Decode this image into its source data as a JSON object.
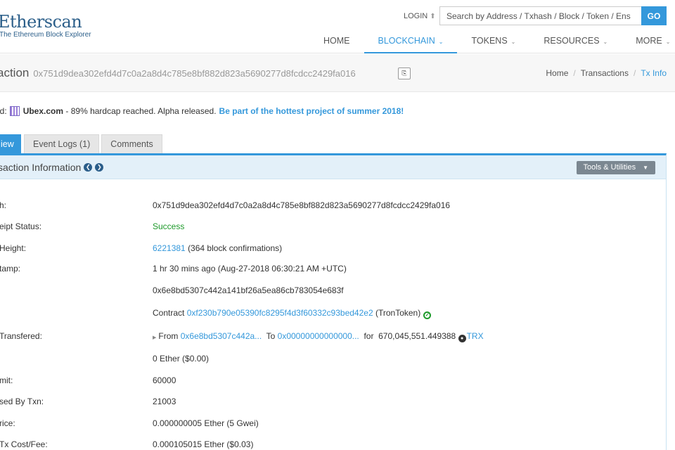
{
  "header": {
    "logo": "Etherscan",
    "logo_tagline": "The Ethereum Block Explorer",
    "login": "LOGIN",
    "search_placeholder": "Search by Address / Txhash / Block / Token / Ens",
    "go": "GO",
    "nav": [
      "HOME",
      "BLOCKCHAIN",
      "TOKENS",
      "RESOURCES",
      "MORE"
    ]
  },
  "title": {
    "heading": "action",
    "hash": "0x751d9dea302efd4d7c0a2a8d4c785e8bf882d823a5690277d8fcdcc2429fa016"
  },
  "breadcrumb": [
    "Home",
    "Transactions",
    "Tx Info"
  ],
  "sponsor": {
    "prefix": "ed:",
    "brand": "Ubex.com",
    "text": "- 89% hardcap reached. Alpha released.",
    "link": "Be part of the hottest project of summer 2018!"
  },
  "tabs": [
    "iew",
    "Event Logs (1)",
    "Comments"
  ],
  "panel": {
    "title": "saction Information",
    "tools": "Tools & Utilities"
  },
  "details": {
    "hash_label": "h:",
    "hash_value": "0x751d9dea302efd4d7c0a2a8d4c785e8bf882d823a5690277d8fcdcc2429fa016",
    "status_label": "eipt Status:",
    "status_value": "Success",
    "height_label": "Height:",
    "height_block": "6221381",
    "height_confirm": "(364 block confirmations)",
    "timestamp_label": "tamp:",
    "timestamp_value": "1 hr 30 mins ago (Aug-27-2018 06:30:21 AM +UTC)",
    "from_value": "0x6e8bd5307c442a141bf26a5ea86cb783054e683f",
    "contract_prefix": "Contract",
    "contract_address": "0xf230b790e05390fc8295f4d3f60332c93bed42e2",
    "contract_name": "(TronToken)",
    "tokens_label": "Transfered:",
    "tokens_from_prefix": "From",
    "tokens_from": "0x6e8bd5307c442a...",
    "tokens_to_prefix": "To",
    "tokens_to": "0x00000000000000...",
    "tokens_for_prefix": "for",
    "tokens_amount": "670,045,551.449388",
    "tokens_symbol": "TRX",
    "value_value": "0 Ether ($0.00)",
    "gaslimit_label": "mit:",
    "gaslimit_value": "60000",
    "gasused_label": "sed By Txn:",
    "gasused_value": "21003",
    "gasprice_label": "rice:",
    "gasprice_value": "0.000000005 Ether (5 Gwei)",
    "txfee_label": "Tx Cost/Fee:",
    "txfee_value": "0.000105015 Ether ($0.03)"
  },
  "colors": {
    "accent": "#3498db",
    "success": "#1e9a2b",
    "logo": "#2c5f8a"
  }
}
